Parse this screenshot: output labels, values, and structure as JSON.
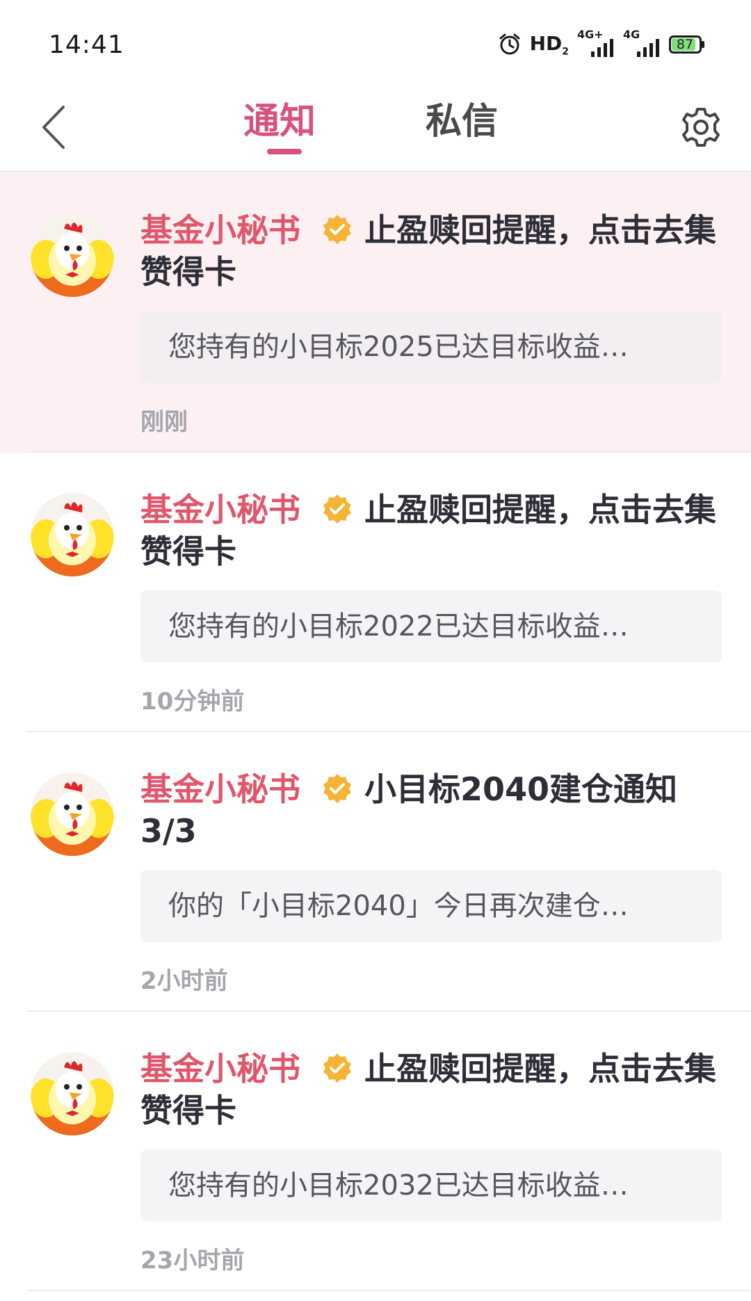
{
  "status_bar": {
    "time": "14:41",
    "hd_label": "HD",
    "hd_sub": "2",
    "net1_label": "4G+",
    "net2_label": "4G",
    "battery": "87"
  },
  "header": {
    "tabs": [
      {
        "label": "通知",
        "active": true
      },
      {
        "label": "私信",
        "active": false
      }
    ],
    "accent_color": "#d9517e"
  },
  "notifications": [
    {
      "sender": "基金小秘书",
      "title": "止盈赎回提醒，点击去集赞得卡",
      "preview": "您持有的小目标2025已达目标收益…",
      "time": "刚刚",
      "highlighted": true
    },
    {
      "sender": "基金小秘书",
      "title": "止盈赎回提醒，点击去集赞得卡",
      "preview": "您持有的小目标2022已达目标收益…",
      "time": "10分钟前",
      "highlighted": false
    },
    {
      "sender": "基金小秘书",
      "title": "小目标2040建仓通知3/3",
      "preview": "你的「小目标2040」今日再次建仓…",
      "time": "2小时前",
      "highlighted": false
    },
    {
      "sender": "基金小秘书",
      "title": "止盈赎回提醒，点击去集赞得卡",
      "preview": "您持有的小目标2032已达目标收益…",
      "time": "23小时前",
      "highlighted": false
    }
  ],
  "icons": {
    "back": "chevron-left-icon",
    "settings": "gear-icon",
    "verified": "verified-badge-icon",
    "avatar": "chicken-mascot-avatar"
  }
}
